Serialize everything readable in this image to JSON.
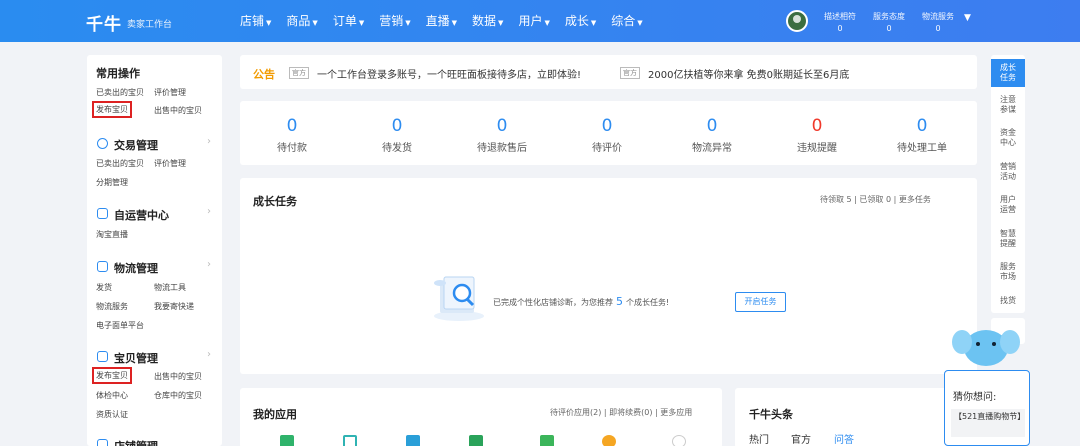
{
  "topbar": {
    "brand": "千牛",
    "brand_sub": "卖家工作台",
    "nav": [
      "店铺",
      "商品",
      "订单",
      "营销",
      "直播",
      "数据",
      "用户",
      "成长",
      "综合"
    ],
    "stats": [
      {
        "label": "描述相符",
        "value": "0"
      },
      {
        "label": "服务态度",
        "value": "0"
      },
      {
        "label": "物流服务",
        "value": "0"
      }
    ]
  },
  "sidebar": {
    "common_title": "常用操作",
    "common_links": [
      "已卖出的宝贝",
      "评价管理",
      "发布宝贝",
      "出售中的宝贝"
    ],
    "trade_title": "交易管理",
    "trade_links": [
      "已卖出的宝贝",
      "评价管理",
      "分期管理"
    ],
    "self_title": "自运营中心",
    "self_links": [
      "淘宝直播"
    ],
    "logistics_title": "物流管理",
    "logistics_links": [
      "发货",
      "物流工具",
      "物流服务",
      "我要寄快递",
      "电子面单平台"
    ],
    "goods_title": "宝贝管理",
    "goods_links": [
      "发布宝贝",
      "出售中的宝贝",
      "体检中心",
      "仓库中的宝贝",
      "资质认证"
    ],
    "store_title": "店铺管理"
  },
  "notice": {
    "title": "公告",
    "items": [
      {
        "tag": "官方",
        "text": "一个工作台登录多账号，一个旺旺面板接待多店，立即体验!"
      },
      {
        "tag": "官方",
        "text": "2000亿扶植等你来拿 免费0账期延长至6月底"
      }
    ]
  },
  "order_stats": [
    {
      "value": "0",
      "label": "待付款"
    },
    {
      "value": "0",
      "label": "待发货"
    },
    {
      "value": "0",
      "label": "待退款售后"
    },
    {
      "value": "0",
      "label": "待评价"
    },
    {
      "value": "0",
      "label": "物流异常"
    },
    {
      "value": "0",
      "label": "违规提醒"
    },
    {
      "value": "0",
      "label": "待处理工单"
    }
  ],
  "growth": {
    "title": "成长任务",
    "meta": "待领取 5  |  已领取 0  |  更多任务",
    "empty_pre": "已完成个性化店铺诊断，为您推荐",
    "empty_num": "5",
    "empty_post": "个成长任务!",
    "start_button": "开启任务"
  },
  "apps": {
    "title": "我的应用",
    "meta": "待评价应用(2)  |  即将续费(0)  |  更多应用"
  },
  "news": {
    "title": "千牛头条",
    "tabs": [
      "热门",
      "官方",
      "问答"
    ]
  },
  "rightbar": {
    "items": [
      "成长任务",
      "注意参谋",
      "资金中心",
      "营销活动",
      "用户运营",
      "智慧提醒",
      "服务市场",
      "找货"
    ]
  },
  "assistant": {
    "title": "猜你想问:",
    "question": "【521直播购物节】"
  },
  "colors": {
    "accent": "#2d8cf0",
    "warning": "#f0392b",
    "notice": "#f29b00",
    "highlight": "#dd2222"
  }
}
